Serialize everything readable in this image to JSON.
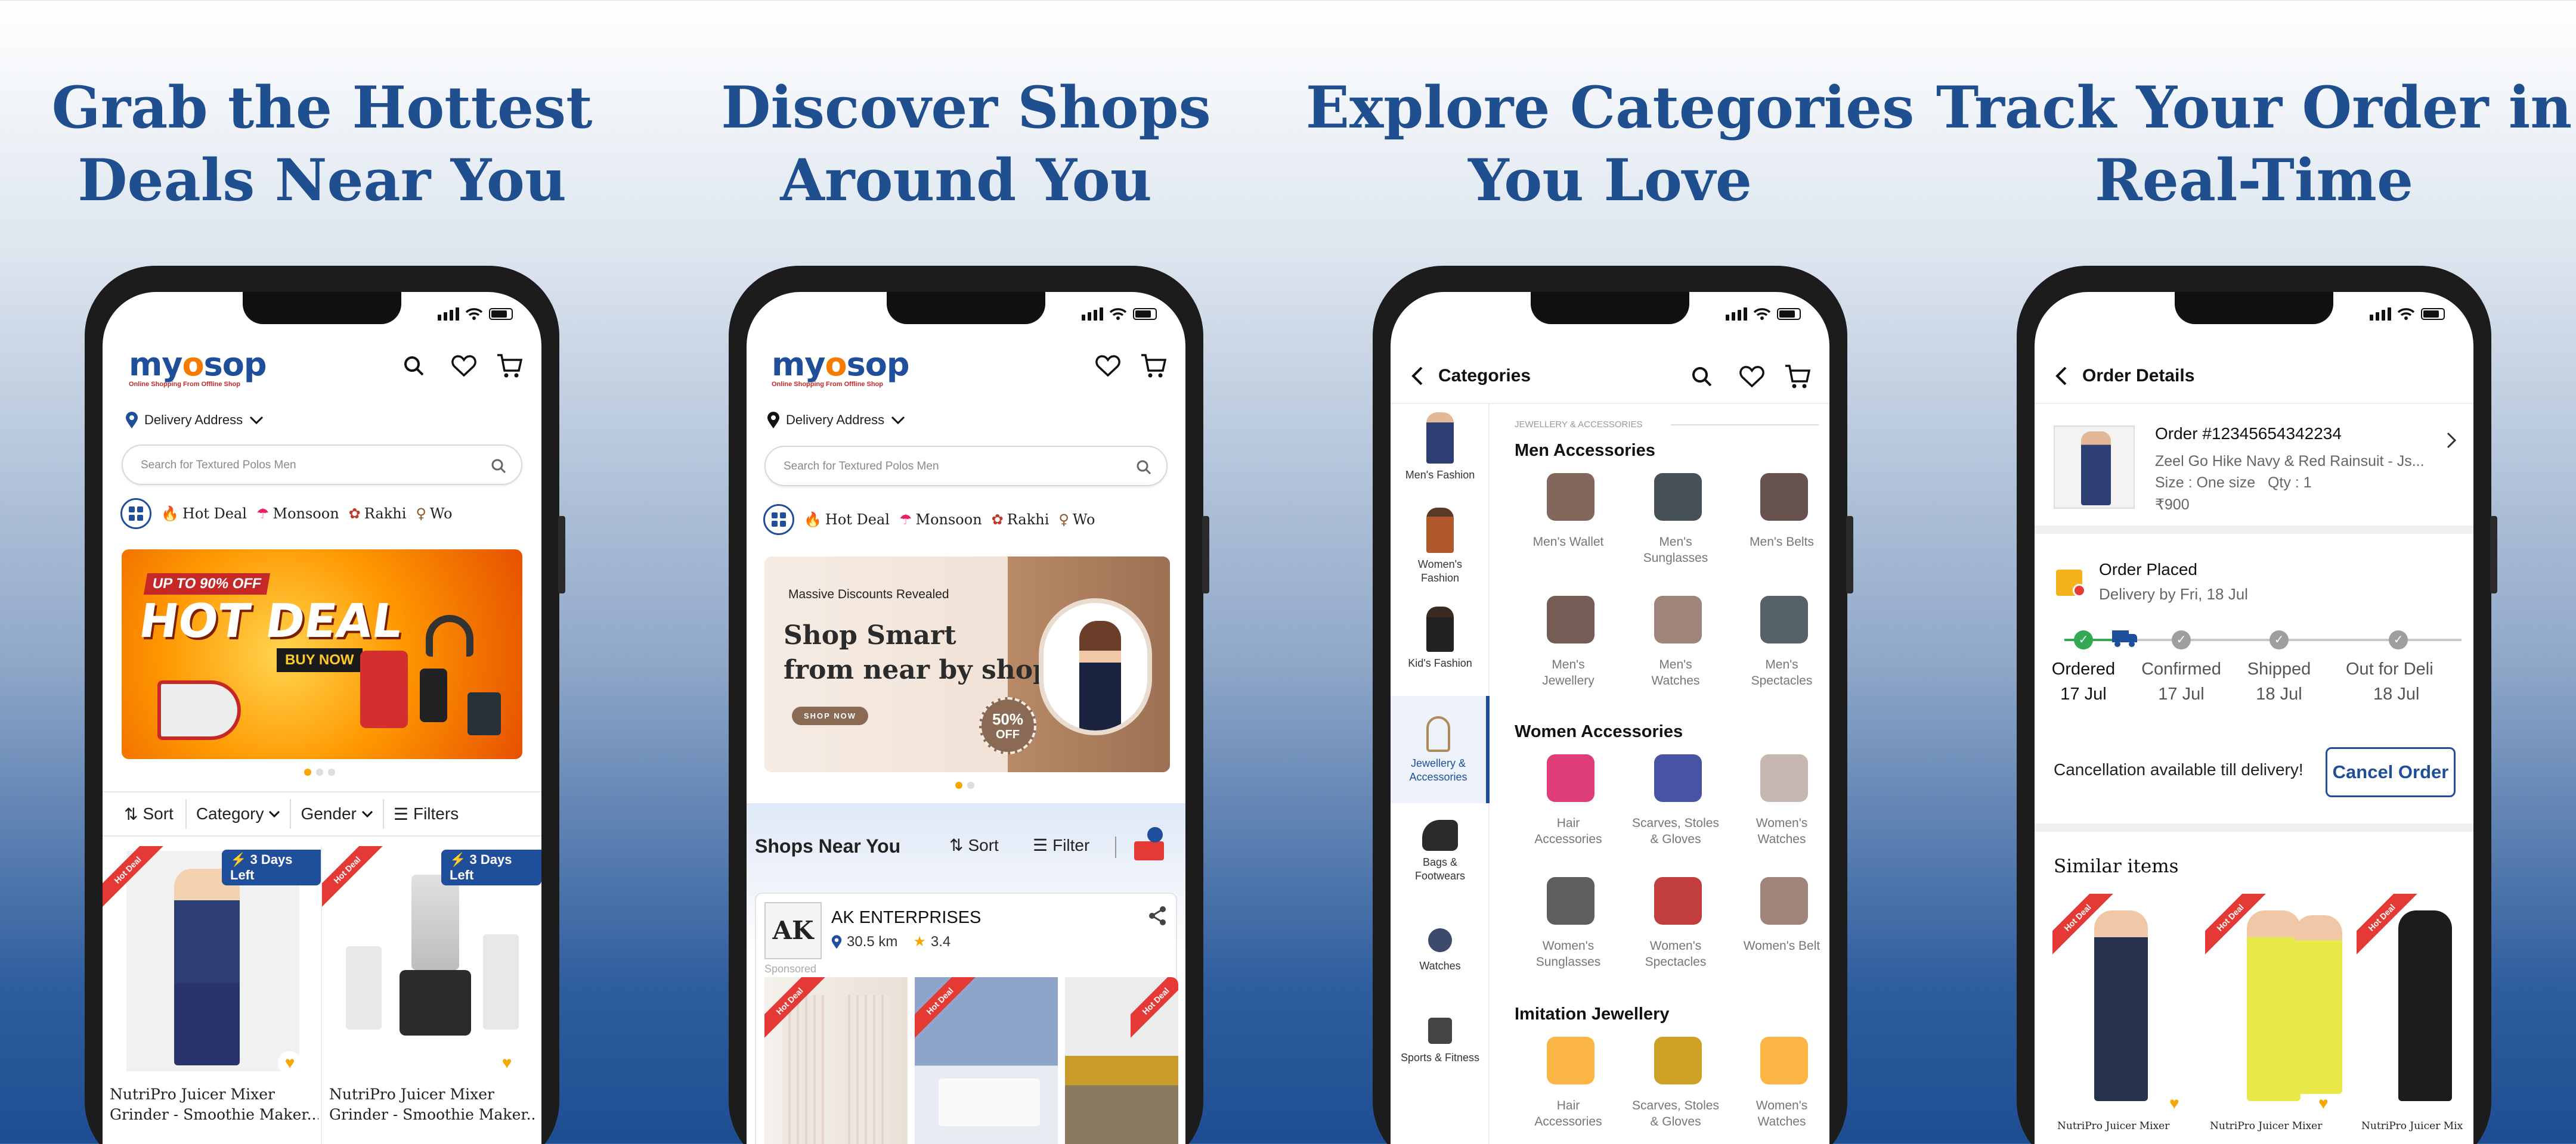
{
  "headlines": [
    "Grab the Hottest Deals Near You",
    "Discover Shops Around You",
    "Explore Categories You Love",
    "Track Your Order in Real-Time"
  ],
  "brand": {
    "name_a": "my",
    "name_b": "o",
    "name_c": "sop",
    "tagline": "Online Shopping From Offline Shop",
    "primary_color": "#1f4f9a",
    "accent_color": "#f57c00"
  },
  "common": {
    "delivery_address": "Delivery Address",
    "search_placeholder": "Search for Textured Polos Men",
    "chips": [
      "Hot Deal",
      "Monsoon",
      "Rakhi",
      "Wo"
    ]
  },
  "screen1": {
    "banner": {
      "top": "UP TO 90% OFF",
      "title": "HOT DEAL",
      "cta": "BUY NOW"
    },
    "toolbar": {
      "sort": "Sort",
      "category": "Category",
      "gender": "Gender",
      "filters": "Filters"
    },
    "products": [
      {
        "ribbon": "Hot Deal",
        "badge": "3 Days Left",
        "title_line1": "NutriPro Juicer Mixer",
        "title_line2": "Grinder - Smoothie Maker..."
      },
      {
        "ribbon": "Hot Deal",
        "badge": "3 Days Left",
        "title_line1": "NutriPro Juicer Mixer",
        "title_line2": "Grinder - Smoothie Maker..."
      }
    ]
  },
  "screen2": {
    "banner": {
      "eyebrow": "Massive Discounts Revealed",
      "line1": "Shop Smart",
      "line2": "from near by shop",
      "cta": "SHOP NOW",
      "badge_top": "50%",
      "badge_bottom": "OFF"
    },
    "section_title": "Shops Near You",
    "sort": "Sort",
    "filter": "Filter",
    "shop": {
      "name": "AK ENTERPRISES",
      "distance": "30.5 km",
      "rating": "3.4",
      "sponsored": "Sponsored",
      "logo_text": "AK"
    },
    "ribbon": "Hot Deal"
  },
  "screen3": {
    "header": "Categories",
    "sidebar": [
      {
        "line1": "Men's Fashion",
        "line2": ""
      },
      {
        "line1": "Women's",
        "line2": "Fashion"
      },
      {
        "line1": "Kid's Fashion",
        "line2": ""
      },
      {
        "line1": "Jewellery &",
        "line2": "Accessories"
      },
      {
        "line1": "Bags &",
        "line2": "Footwears"
      },
      {
        "line1": "Watches",
        "line2": ""
      },
      {
        "line1": "Sports & Fitness",
        "line2": ""
      }
    ],
    "crumb": "JEWELLERY & ACCESSORIES",
    "sections": [
      {
        "title": "Men Accessories",
        "items": [
          {
            "l1": "Men's Wallet",
            "l2": ""
          },
          {
            "l1": "Men's",
            "l2": "Sunglasses"
          },
          {
            "l1": "Men's Belts",
            "l2": ""
          },
          {
            "l1": "Men's",
            "l2": "Jewellery"
          },
          {
            "l1": "Men's",
            "l2": "Watches"
          },
          {
            "l1": "Men's",
            "l2": "Spectacles"
          }
        ]
      },
      {
        "title": "Women Accessories",
        "items": [
          {
            "l1": "Hair",
            "l2": "Accessories"
          },
          {
            "l1": "Scarves, Stoles",
            "l2": "& Gloves"
          },
          {
            "l1": "Women's",
            "l2": "Watches"
          },
          {
            "l1": "Women's",
            "l2": "Sunglasses"
          },
          {
            "l1": "Women's",
            "l2": "Spectacles"
          },
          {
            "l1": "Women's Belt",
            "l2": ""
          }
        ]
      },
      {
        "title": "Imitation Jewellery",
        "items": [
          {
            "l1": "Hair",
            "l2": "Accessories"
          },
          {
            "l1": "Scarves, Stoles",
            "l2": "& Gloves"
          },
          {
            "l1": "Women's",
            "l2": "Watches"
          }
        ]
      }
    ]
  },
  "screen4": {
    "header": "Order Details",
    "order": {
      "id": "Order #12345654342234",
      "name": "Zeel Go Hike Navy & Red Rainsuit - Js...",
      "size": "Size : One size",
      "qty": "Qty : 1",
      "price": "₹900"
    },
    "status": {
      "title": "Order Placed",
      "eta": "Delivery by Fri, 18 Jul"
    },
    "steps": [
      {
        "label": "Ordered",
        "date": "17 Jul",
        "done": true
      },
      {
        "label": "Confirmed",
        "date": "17 Jul",
        "done": false
      },
      {
        "label": "Shipped",
        "date": "18 Jul",
        "done": false
      },
      {
        "label": "Out for Delivery",
        "date": "18 Jul",
        "done": false
      }
    ],
    "cancel_note": "Cancellation available till delivery!",
    "cancel_button": "Cancel Order",
    "similar_title": "Similar items",
    "similar_ribbon": "Hot Deal",
    "similar_names": [
      "NutriPro Juicer Mixer",
      "NutriPro Juicer Mixer",
      "NutriPro Juicer Mix"
    ]
  }
}
